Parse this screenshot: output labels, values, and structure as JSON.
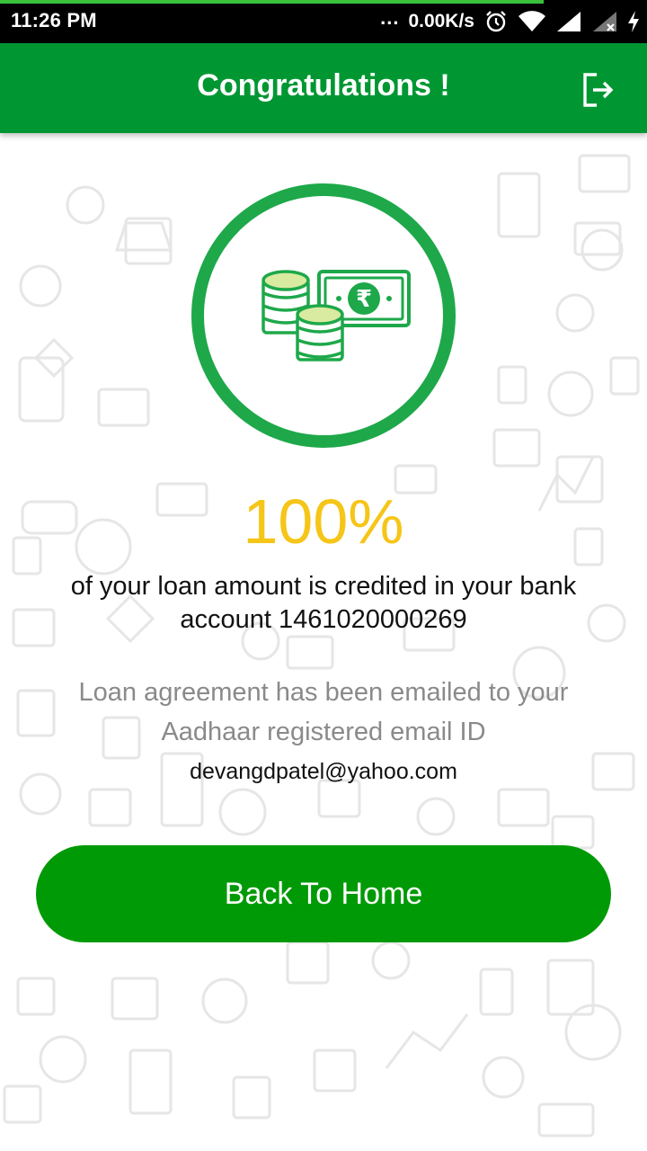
{
  "status_bar": {
    "time": "11:26 PM",
    "dots": "...",
    "network_speed": "0.00K/s",
    "icons": [
      "alarm-icon",
      "wifi-icon",
      "signal-icon",
      "signal-no-service-icon",
      "charging-icon"
    ],
    "progress": 0.84,
    "progress_color": "#39c13c"
  },
  "app_bar": {
    "title": "Congratulations !",
    "logout_icon": "logout-icon",
    "color": "#009733"
  },
  "hero": {
    "icon": "money-coins-icon",
    "currency_symbol": "₹",
    "ring_color": "#1ea84a"
  },
  "result": {
    "percent": "100%",
    "percent_color": "#f5c518",
    "credit_message": "of your loan amount is credited in your bank account 1461020000269",
    "agreement_message": "Loan agreement has been emailed to your Aadhaar registered email ID",
    "email": "devangdpatel@yahoo.com"
  },
  "actions": {
    "home_button_label": "Back To Home",
    "button_color": "#009a06"
  }
}
